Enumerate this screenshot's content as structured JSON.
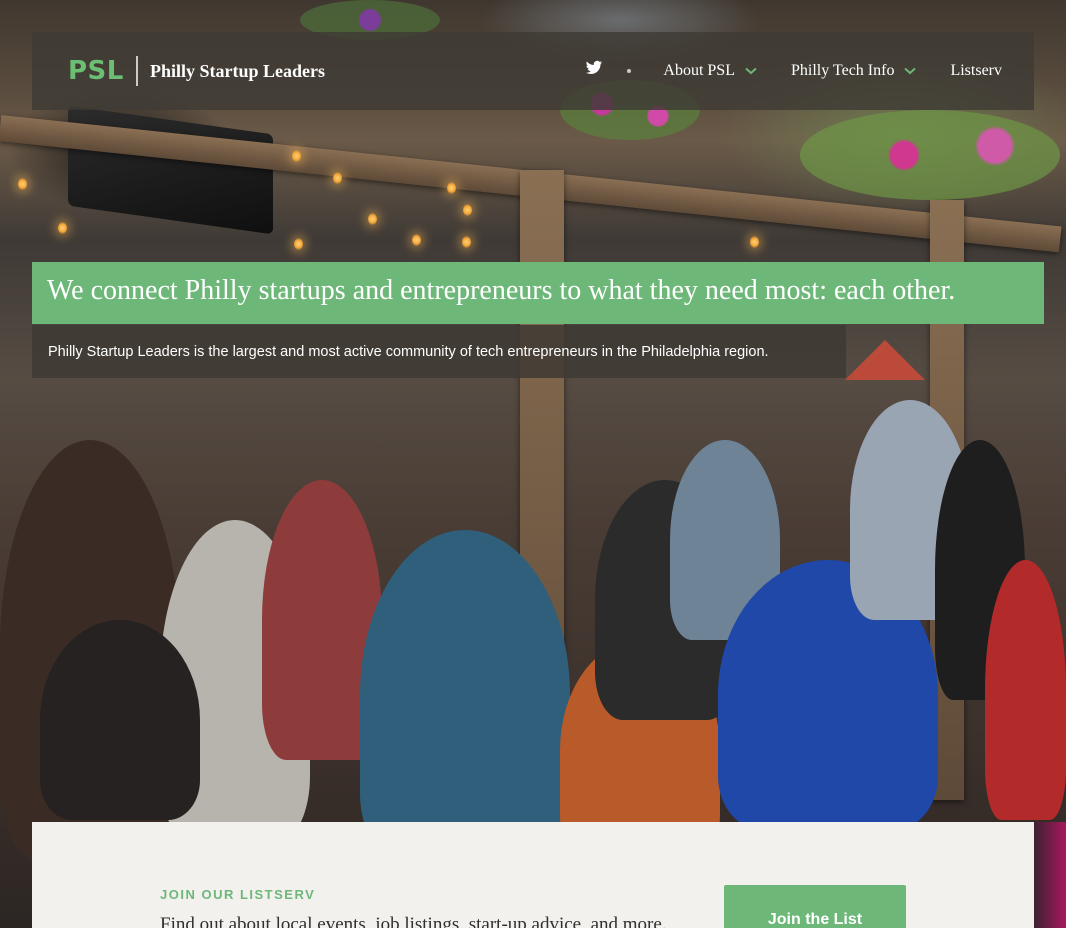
{
  "brand": {
    "logo_mark": "PSL",
    "name": "Philly Startup Leaders",
    "accent_color": "#6db878"
  },
  "nav": {
    "social_icon": "twitter-icon",
    "items": [
      {
        "label": "About PSL",
        "has_dropdown": true
      },
      {
        "label": "Philly Tech Info",
        "has_dropdown": true
      },
      {
        "label": "Listserv",
        "has_dropdown": false
      }
    ]
  },
  "hero": {
    "headline": "We connect Philly startups and entrepreneurs to what they need most: each other.",
    "subline": "Philly Startup Leaders is the largest and most active community of tech entrepreneurs in the Philadelphia region."
  },
  "listserv": {
    "kicker": "JOIN OUR LISTSERV",
    "text": "Find out about local events, job listings, start-up advice, and more.",
    "button_label": "Join the List"
  }
}
